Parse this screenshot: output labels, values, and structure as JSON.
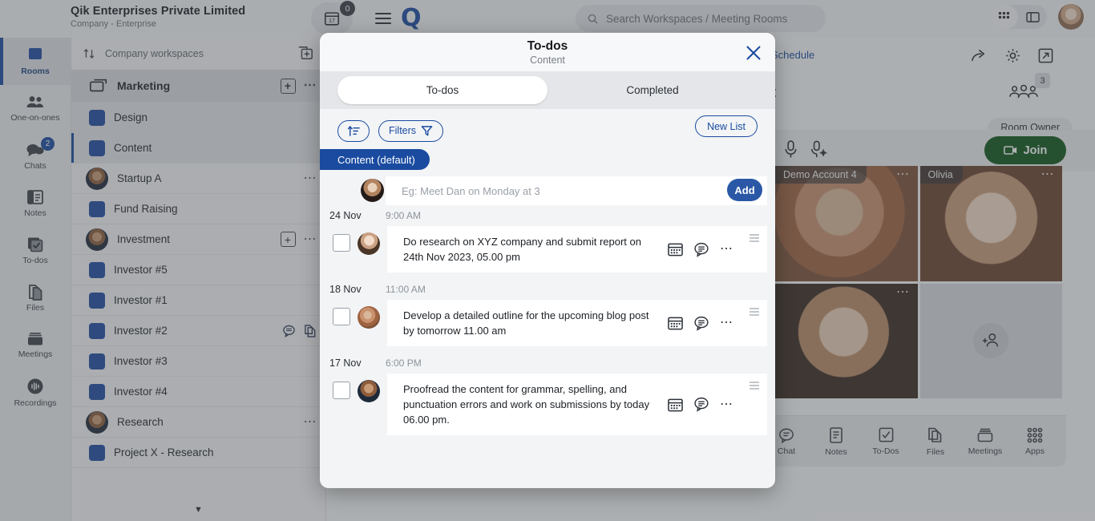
{
  "header": {
    "org_name": "Qik Enterprises Private Limited",
    "org_sub": "Company - Enterprise",
    "calendar_day": "17",
    "calendar_badge": "0",
    "logo_text": "Q",
    "search_placeholder": "Search Workspaces / Meeting Rooms",
    "icons": {
      "menu": "hamburger-icon",
      "search": "search-icon",
      "grid_view": "grid-view-icon",
      "panel_view": "panel-view-icon",
      "avatar": "user-avatar"
    }
  },
  "rail": {
    "items": [
      {
        "label": "Rooms",
        "icon": "rooms-icon",
        "active": true,
        "badge": ""
      },
      {
        "label": "One-on-ones",
        "icon": "people-icon",
        "active": false,
        "badge": ""
      },
      {
        "label": "Chats",
        "icon": "chat-icon",
        "active": false,
        "badge": "2"
      },
      {
        "label": "Notes",
        "icon": "notes-icon",
        "active": false,
        "badge": ""
      },
      {
        "label": "To-dos",
        "icon": "todos-icon",
        "active": false,
        "badge": ""
      },
      {
        "label": "Files",
        "icon": "files-icon",
        "active": false,
        "badge": ""
      },
      {
        "label": "Meetings",
        "icon": "meetings-icon",
        "active": false,
        "badge": ""
      },
      {
        "label": "Recordings",
        "icon": "recordings-icon",
        "active": false,
        "badge": ""
      }
    ]
  },
  "workspaces": {
    "header_label": "Company workspaces",
    "sort_icon": "sort-icon",
    "add_icon": "add-workspace-icon",
    "rows": [
      {
        "name": "Marketing",
        "type": "group",
        "icon": "folder-icon",
        "has_plus": true,
        "has_dots": true,
        "state": "sel-group"
      },
      {
        "name": "Design",
        "type": "child",
        "icon": "square-icon",
        "has_plus": false,
        "has_dots": false,
        "state": "selected"
      },
      {
        "name": "Content",
        "type": "child",
        "icon": "square-icon",
        "has_plus": false,
        "has_dots": false,
        "state": "current"
      },
      {
        "name": "Startup A",
        "type": "person",
        "icon": "avatar",
        "has_plus": false,
        "has_dots": true,
        "state": ""
      },
      {
        "name": "Fund Raising",
        "type": "child",
        "icon": "square-icon",
        "has_plus": false,
        "has_dots": false,
        "state": ""
      },
      {
        "name": "Investment",
        "type": "person",
        "icon": "avatar",
        "has_plus": true,
        "has_dots": true,
        "state": ""
      },
      {
        "name": "Investor #5",
        "type": "child",
        "icon": "square-icon",
        "has_plus": false,
        "has_dots": false,
        "state": ""
      },
      {
        "name": "Investor #1",
        "type": "child",
        "icon": "square-icon",
        "has_plus": false,
        "has_dots": false,
        "state": ""
      },
      {
        "name": "Investor #2",
        "type": "child",
        "icon": "square-icon",
        "has_plus": false,
        "has_dots": false,
        "state": "hover"
      },
      {
        "name": "Investor #3",
        "type": "child",
        "icon": "square-icon",
        "has_plus": false,
        "has_dots": false,
        "state": ""
      },
      {
        "name": "Investor #4",
        "type": "child",
        "icon": "square-icon",
        "has_plus": false,
        "has_dots": false,
        "state": ""
      },
      {
        "name": "Research",
        "type": "person",
        "icon": "avatar",
        "has_plus": false,
        "has_dots": true,
        "state": ""
      },
      {
        "name": "Project X - Research",
        "type": "child",
        "icon": "square-icon",
        "has_plus": false,
        "has_dots": false,
        "state": ""
      }
    ]
  },
  "room": {
    "schedule_label": "Schedule",
    "title": "Content",
    "participant_count": "3",
    "owner_label": "Room Owner",
    "join_label": "Join",
    "tiles": [
      {
        "name": "Demo Account 4",
        "empty": false
      },
      {
        "name": "Olivia",
        "empty": false
      },
      {
        "name": "",
        "empty": false
      },
      {
        "name": "",
        "empty": true
      }
    ],
    "bottom_nav": [
      {
        "label": "Chat",
        "icon": "chat-icon"
      },
      {
        "label": "Notes",
        "icon": "notes-icon"
      },
      {
        "label": "To-Dos",
        "icon": "todos-icon"
      },
      {
        "label": "Files",
        "icon": "files-icon"
      },
      {
        "label": "Meetings",
        "icon": "meetings-icon"
      },
      {
        "label": "Apps",
        "icon": "apps-icon"
      }
    ]
  },
  "modal": {
    "title": "To-dos",
    "subtitle": "Content",
    "close_icon": "close-icon",
    "tabs": [
      {
        "label": "To-dos",
        "active": true
      },
      {
        "label": "Completed",
        "active": false
      }
    ],
    "sort_icon": "sort-ascending-icon",
    "filters_label": "Filters",
    "filters_icon": "filter-icon",
    "new_list_label": "New List",
    "list_chip_label": "Content (default)",
    "new_task_placeholder": "Eg: Meet Dan on Monday at 3",
    "add_button_label": "Add",
    "groups": [
      {
        "date": "24 Nov",
        "time": "9:00 AM",
        "text": "Do research on XYZ company and submit report on 24th Nov 2023, 05.00 pm"
      },
      {
        "date": "18 Nov",
        "time": "11:00 AM",
        "text": "Develop a detailed outline for the upcoming blog post by tomorrow 11.00 am"
      },
      {
        "date": "17 Nov",
        "time": "6:00 PM",
        "text": "Proofread the content for grammar, spelling, and punctuation errors and work on submissions by today 06.00 pm."
      }
    ],
    "task_icons": {
      "calendar": "calendar-icon",
      "comment": "comment-icon",
      "more": "more-options-icon",
      "drag": "drag-handle-icon"
    }
  },
  "colors": {
    "brand_blue": "#1a4ba0",
    "add_blue": "#2b58a6",
    "join_green": "#10561a",
    "chip_blue": "#1a4ba0",
    "square_blue": "#1f4ba0"
  }
}
